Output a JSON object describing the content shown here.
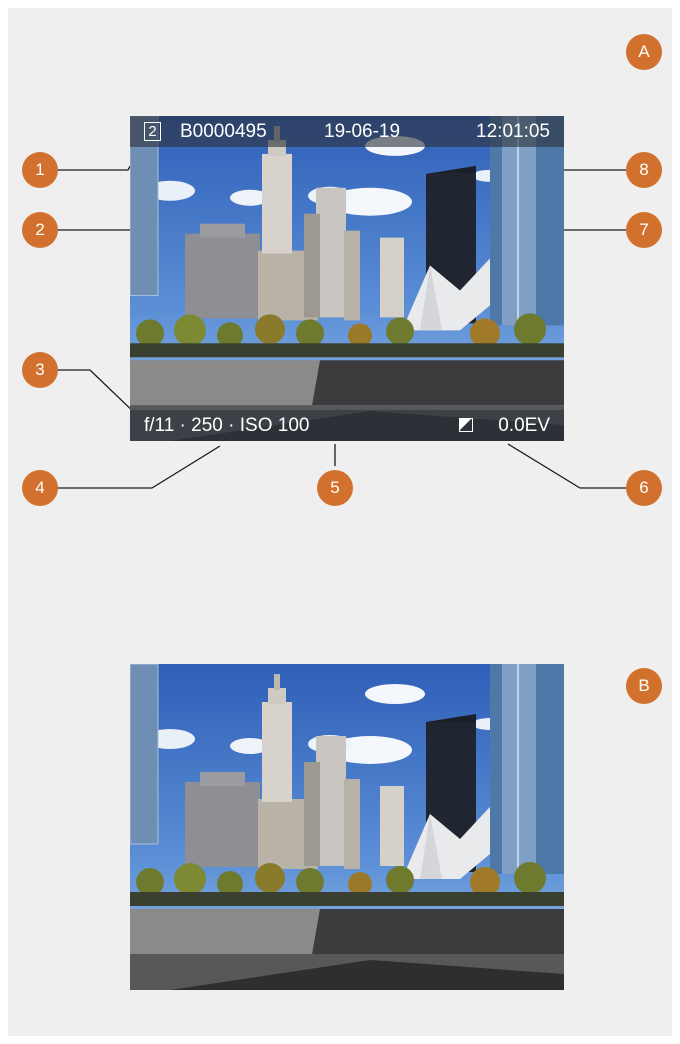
{
  "figures": [
    {
      "label": "A",
      "overlay": {
        "card_slot": "2",
        "file_name": "B0000495",
        "date": "19-06-19",
        "time": "12:01:05",
        "exposure": "f/11 · 250 · ISO 100",
        "ev_value": "0.0EV"
      },
      "callouts": [
        "1",
        "2",
        "3",
        "4",
        "5",
        "6",
        "7",
        "8"
      ]
    },
    {
      "label": "B"
    }
  ],
  "colors": {
    "callout": "#d2712d",
    "overlay": "#2d323c",
    "panel": "#efefef"
  },
  "icons": [
    "exposure-compensation-icon"
  ]
}
